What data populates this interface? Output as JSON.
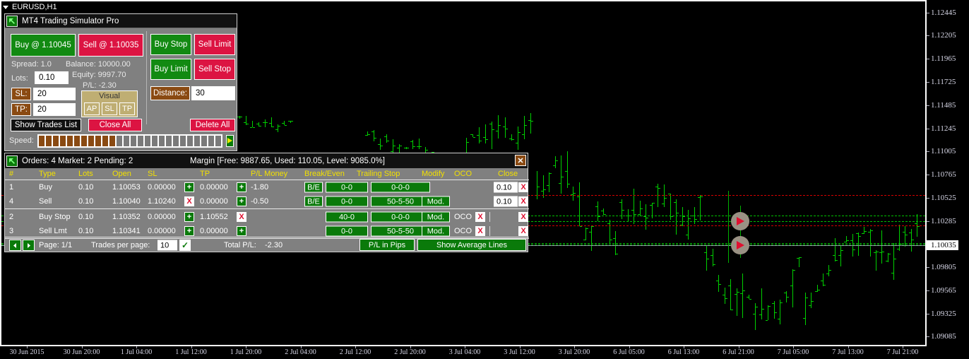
{
  "symbol": {
    "label": "EURUSD,H1",
    "caret_icon": "caret-down-icon"
  },
  "panel": {
    "title": "MT4 Trading Simulator Pro",
    "logo_icon": "arrow-up-left-icon",
    "buy_button": "Buy @ 1.10045",
    "sell_button": "Sell @ 1.10035",
    "buy_stop": "Buy Stop",
    "sell_limit": "Sell Limit",
    "buy_limit": "Buy Limit",
    "sell_stop": "Sell Stop",
    "spread": "Spread: 1.0",
    "balance": "Balance: 10000.00",
    "equity": "Equity: 9997.70",
    "pl": "P/L: -2.30",
    "lots_label": "Lots:",
    "lots_value": "0.10",
    "sl_label": "SL:",
    "sl_value": "20",
    "tp_label": "TP:",
    "tp_value": "20",
    "visual_caption": "Visual",
    "visual_ap": "AP",
    "visual_sl": "SL",
    "visual_tp": "TP",
    "distance_label": "Distance:",
    "distance_value": "30",
    "show_trades_list": "Show Trades List",
    "close_all": "Close All",
    "delete_all": "Delete All",
    "speed_label": "Speed:",
    "speed_filled": 11,
    "speed_total": 26,
    "play_icon": "play-icon"
  },
  "orders": {
    "summary": "Orders: 4  Market: 2  Pending: 2",
    "margin": "Margin  [Free: 9887.65, Used: 110.05, Level: 9085.0%]",
    "logo_icon": "arrow-up-left-icon",
    "close_icon": "close-icon",
    "columns": [
      "#",
      "Type",
      "Lots",
      "Open",
      "SL",
      "TP",
      "P/L Money",
      "Break/Even",
      "Trailing Stop",
      "Modify",
      "OCO",
      "Close"
    ],
    "rows": [
      {
        "num": "1",
        "type": "Buy",
        "lots": "0.10",
        "open": "1.10053",
        "sl": "0.00000",
        "sl_btn": "+",
        "sl_btn_kind": "green",
        "tp": "0.00000",
        "tp_btn": "+",
        "tp_btn_kind": "green",
        "pl": "-1.80",
        "be_label": "B/E",
        "be_value": "0-0",
        "trailing": "0-0-0",
        "modify": "",
        "oco": "",
        "close_value": "0.10",
        "has_close_field": true
      },
      {
        "num": "4",
        "type": "Sell",
        "lots": "0.10",
        "open": "1.10040",
        "sl": "1.10240",
        "sl_btn": "X",
        "sl_btn_kind": "red",
        "tp": "0.00000",
        "tp_btn": "+",
        "tp_btn_kind": "green",
        "pl": "-0.50",
        "be_label": "B/E",
        "be_value": "0-0",
        "trailing": "50-5-50",
        "modify": "Mod.",
        "oco": "",
        "close_value": "0.10",
        "has_close_field": true
      },
      {
        "num": "2",
        "type": "Buy Stop",
        "lots": "0.10",
        "open": "1.10352",
        "sl": "0.00000",
        "sl_btn": "+",
        "sl_btn_kind": "green",
        "tp": "1.10552",
        "tp_btn": "X",
        "tp_btn_kind": "red",
        "pl": "",
        "be_label": "",
        "be_value": "40-0",
        "trailing": "0-0-0",
        "modify": "Mod.",
        "oco": "OCO",
        "close_value": "",
        "has_close_field": false
      },
      {
        "num": "3",
        "type": "Sell Lmt",
        "lots": "0.10",
        "open": "1.10341",
        "sl": "0.00000",
        "sl_btn": "+",
        "sl_btn_kind": "green",
        "tp": "0.00000",
        "tp_btn": "+",
        "tp_btn_kind": "green",
        "pl": "",
        "be_label": "",
        "be_value": "0-0",
        "trailing": "50-5-50",
        "modify": "Mod.",
        "oco": "OCO",
        "close_value": "",
        "has_close_field": false
      }
    ],
    "footer": {
      "prev_icon": "arrow-left-icon",
      "next_icon": "arrow-right-icon",
      "page": "Page: 1/1",
      "trades_per_page_label": "Trades per page:",
      "trades_per_page_value": "10",
      "check_icon": "check-icon",
      "total_pl_label": "Total P/L:",
      "total_pl_value": "-2.30",
      "pl_in_pips": "P/L in Pips",
      "show_average_lines": "Show Average Lines"
    }
  },
  "chart_data": {
    "type": "ohlc",
    "title": "EURUSD,H1",
    "xlabel": "",
    "ylabel": "",
    "grid": false,
    "legend": "none",
    "ylim": [
      1.09,
      1.1256
    ],
    "y_ticks": [
      "1.12445",
      "1.12205",
      "1.11965",
      "1.11725",
      "1.11485",
      "1.11245",
      "1.11005",
      "1.10765",
      "1.10525",
      "1.10285",
      "1.10035",
      "1.09805",
      "1.09565",
      "1.09325",
      "1.09085"
    ],
    "current_price": "1.10035",
    "x_ticks": [
      "30 Jun 2015",
      "30 Jun 20:00",
      "1 Jul 04:00",
      "1 Jul 12:00",
      "1 Jul 20:00",
      "2 Jul 04:00",
      "2 Jul 12:00",
      "2 Jul 20:00",
      "3 Jul 04:00",
      "3 Jul 12:00",
      "3 Jul 20:00",
      "6 Jul 05:00",
      "6 Jul 13:00",
      "6 Jul 21:00",
      "7 Jul 05:00",
      "7 Jul 13:00",
      "7 Jul 21:00"
    ],
    "levels": [
      {
        "price": "1.10552",
        "kind": "red"
      },
      {
        "price": "1.10341",
        "kind": "green"
      },
      {
        "price": "1.10285",
        "kind": "green"
      },
      {
        "price": "1.10240",
        "kind": "red"
      },
      {
        "price": "1.10053",
        "kind": "green"
      },
      {
        "price": "1.10040",
        "kind": "green"
      },
      {
        "price": "1.10035",
        "kind": "grey"
      }
    ],
    "markers": [
      {
        "name": "open-trade-marker-1",
        "price": "1.10285"
      },
      {
        "name": "open-trade-marker-2",
        "price": "1.10035"
      }
    ]
  }
}
